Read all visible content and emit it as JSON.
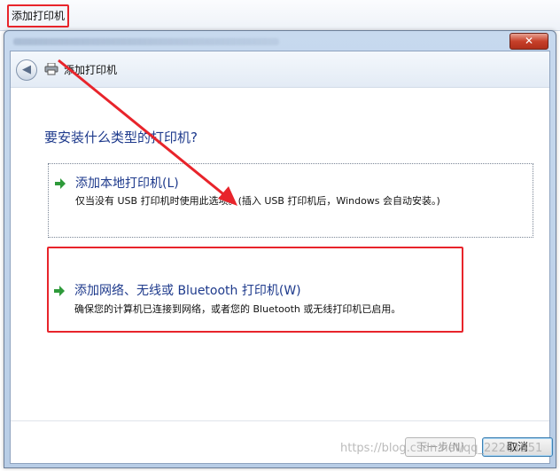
{
  "top_menu": {
    "label": "添加打印机"
  },
  "window": {
    "close_label": "✕",
    "nav_title": "添加打印机",
    "question": "要安装什么类型的打印机?",
    "options": [
      {
        "title": "添加本地打印机(L)",
        "description": "仅当没有 USB 打印机时使用此选项。(插入 USB 打印机后，Windows 会自动安装。)"
      },
      {
        "title": "添加网络、无线或 Bluetooth 打印机(W)",
        "description": "确保您的计算机已连接到网络，或者您的 Bluetooth 或无线打印机已启用。"
      }
    ],
    "buttons": {
      "next": "下一步(N)",
      "cancel": "取消"
    }
  },
  "watermark": "https://blog.csdn.net/qq_22261551",
  "colors": {
    "highlight": "#e8242b",
    "link_blue": "#1e3a8c",
    "arrow_green": "#2e9a3a"
  },
  "icons": [
    "back-arrow-icon",
    "printer-icon",
    "green-arrow-icon",
    "close-icon"
  ]
}
